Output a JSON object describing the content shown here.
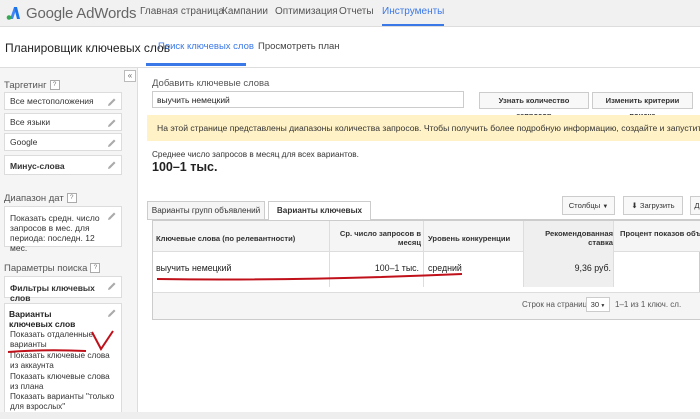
{
  "colors": {
    "accent": "#3b78e7",
    "banner": "#fff2c6",
    "annotation": "#c0101a"
  },
  "brand": {
    "logo_text": "Google AdWords"
  },
  "topnav": [
    "Главная страница",
    "Кампании",
    "Оптимизация",
    "Отчеты",
    "Инструменты"
  ],
  "topnav_active": "Инструменты",
  "subbar": {
    "title": "Планировщик ключевых слов",
    "tabs": [
      "Поиск ключевых слов",
      "Просмотреть план"
    ],
    "active_tab": "Поиск ключевых слов"
  },
  "sidebar": {
    "collapse": "«",
    "targeting_label": "Таргетинг",
    "qmark": "?",
    "targeting_items": [
      "Все местоположения",
      "Все языки",
      "Google",
      "Минус-слова"
    ],
    "date_label": "Диапазон дат",
    "date_text": "Показать средн. число запросов в мес. для периода: последн. 12 мес.",
    "search_params_label": "Параметры поиска",
    "filters": "Фильтры ключевых слов",
    "variants_title": "Варианты ключевых слов",
    "variant_options": [
      "Показать отдаленные варианты",
      "Показать ключевые слова из аккаунта",
      "Показать ключевые слова из плана",
      "Показать варианты \"только для взрослых\""
    ]
  },
  "main": {
    "add_label": "Добавить ключевые слова",
    "keyword_value": "выучить немецкий",
    "btn_get_volume": "Узнать количество запросов",
    "btn_change_criteria": "Изменить критерии поиска",
    "banner": "На этой странице представлены диапазоны количества запросов. Чтобы получить более подробную информацию, создайте и запустите кампан",
    "avg_label": "Среднее число запросов в месяц для всех вариантов.",
    "avg_value": "100–1 тыс.",
    "tabs": [
      "Варианты групп объявлений",
      "Варианты ключевых слов"
    ],
    "active_tab": "Варианты ключевых слов",
    "btn_columns": "Столбцы",
    "btn_download": "Загрузить",
    "btn_more": "Д",
    "table": {
      "headers": [
        "Ключевые слова (по релевантности)",
        "Ср. число запросов в месяц",
        "Уровень конкуренции",
        "Рекомендованная ставка",
        "Процент показов объяв"
      ],
      "rows": [
        [
          "выучить немецкий",
          "100–1 тыс.",
          "средний",
          "9,36 руб.",
          ""
        ]
      ]
    },
    "pagination": {
      "rows_label": "Строк на странице:",
      "rows_value": "30",
      "range": "1–1 из 1 ключ. сл."
    }
  },
  "annotation": {
    "check": "V"
  }
}
